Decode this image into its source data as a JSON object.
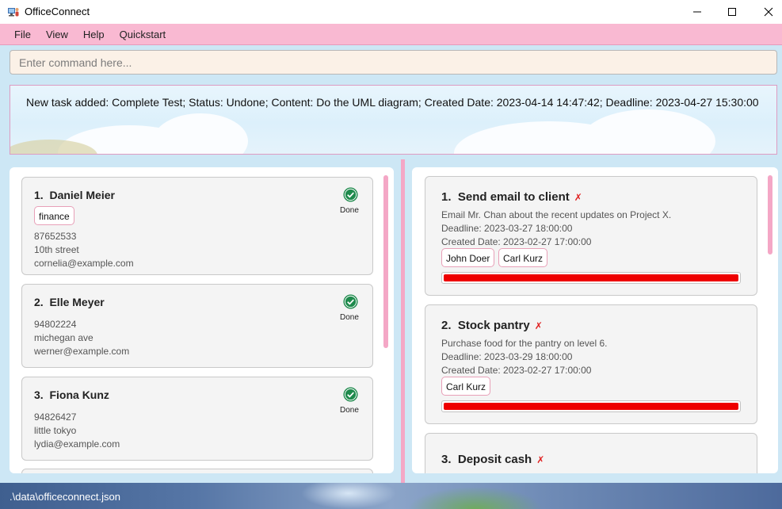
{
  "window": {
    "title": "OfficeConnect"
  },
  "menu": [
    "File",
    "View",
    "Help",
    "Quickstart"
  ],
  "command": {
    "placeholder": "Enter command here...",
    "value": ""
  },
  "result": {
    "text": "New task added: Complete Test; Status: Undone; Content: Do the UML diagram; Created Date: 2023-04-14 14:47:42; Deadline: 2023-04-27 15:30:00"
  },
  "persons": [
    {
      "index": "1.",
      "name": "Daniel Meier",
      "tags": [
        "finance"
      ],
      "phone": "87652533",
      "address": "10th street",
      "email": "cornelia@example.com",
      "status": "Done"
    },
    {
      "index": "2.",
      "name": "Elle Meyer",
      "tags": [],
      "phone": "94802224",
      "address": "michegan ave",
      "email": "werner@example.com",
      "status": "Done"
    },
    {
      "index": "3.",
      "name": "Fiona Kunz",
      "tags": [],
      "phone": "94826427",
      "address": "little tokyo",
      "email": "lydia@example.com",
      "status": "Done"
    }
  ],
  "tasks": [
    {
      "index": "1.",
      "title": "Send email to client",
      "status_mark": "✗",
      "content": "Email Mr. Chan about the recent updates on Project X.",
      "deadline": "Deadline: 2023-03-27 18:00:00",
      "created": "Created Date: 2023-02-27 17:00:00",
      "assignees": [
        "John Doer",
        "Carl Kurz"
      ],
      "progress": 1.0
    },
    {
      "index": "2.",
      "title": "Stock pantry",
      "status_mark": "✗",
      "content": "Purchase food for the pantry on level 6.",
      "deadline": "Deadline: 2023-03-29 18:00:00",
      "created": "Created Date: 2023-02-27 17:00:00",
      "assignees": [
        "Carl Kurz"
      ],
      "progress": 1.0
    },
    {
      "index": "3.",
      "title": "Deposit cash",
      "status_mark": "✗"
    }
  ],
  "statusbar": {
    "path": ".\\data\\officeconnect.json"
  },
  "colors": {
    "accent_pink": "#f9b9d2",
    "background_blue": "#cde7f5",
    "progress_red": "#ee0000",
    "done_green": "#1e8a4c"
  }
}
